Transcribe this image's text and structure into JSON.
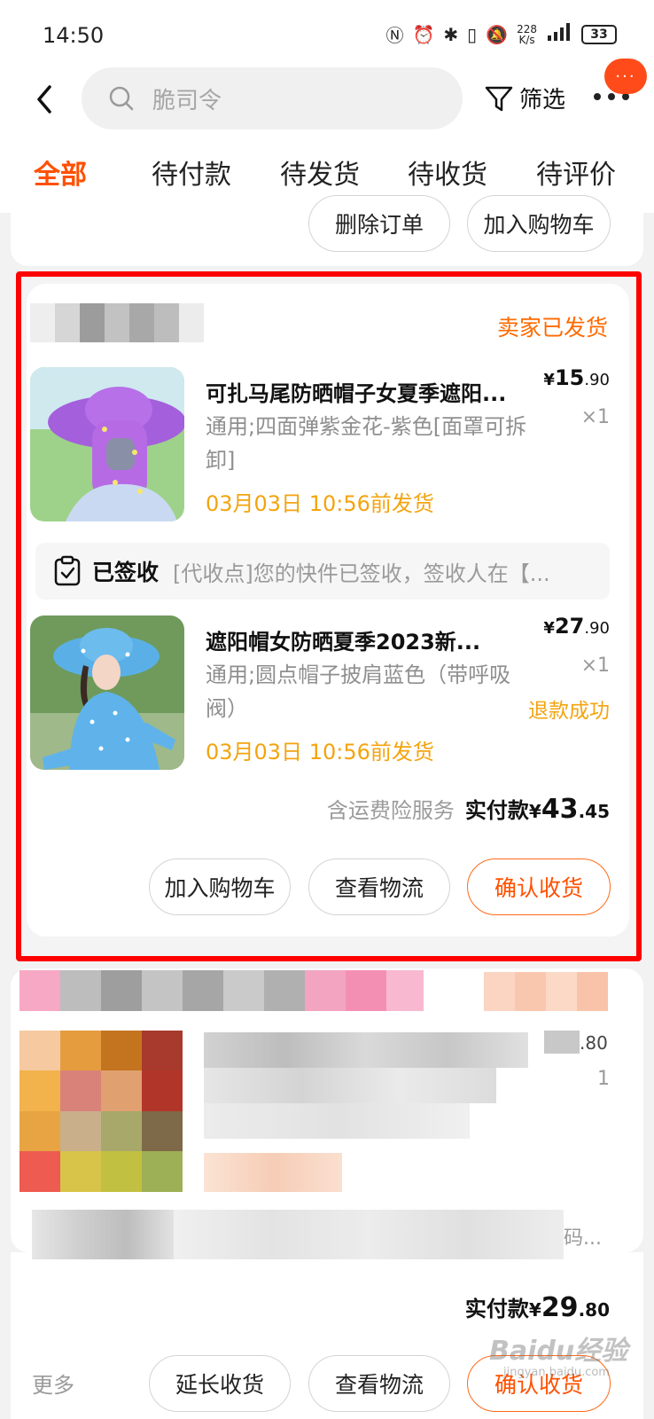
{
  "status_bar": {
    "time": "14:50",
    "net_speed_value": "228",
    "net_speed_unit": "K/s",
    "battery": "33"
  },
  "search": {
    "placeholder": "脆司令"
  },
  "header": {
    "filter_label": "筛选",
    "message_badge": "···"
  },
  "tabs": [
    {
      "label": "全部",
      "active": true
    },
    {
      "label": "待付款",
      "active": false
    },
    {
      "label": "待发货",
      "active": false
    },
    {
      "label": "待收货",
      "active": false
    },
    {
      "label": "待评价",
      "active": false
    }
  ],
  "prev_order": {
    "delete_label": "删除订单",
    "add_cart_label": "加入购物车"
  },
  "order": {
    "status": "卖家已发货",
    "items": [
      {
        "title": "可扎马尾防晒帽子女夏季遮阳...",
        "spec": "通用;四面弹紫金花-紫色[面罩可拆卸]",
        "ship_time": "03月03日 10:56前发货",
        "price_int": "15",
        "price_cents": ".90",
        "qty": "×1",
        "image_name": "purple-sun-hat-photo"
      },
      {
        "title": "遮阳帽女防晒夏季2023新...",
        "spec": "通用;圆点帽子披肩蓝色（带呼吸阀）",
        "ship_time": "03月03日 10:56前发货",
        "price_int": "27",
        "price_cents": ".90",
        "qty": "×1",
        "refund": "退款成功",
        "image_name": "blue-dotted-sun-hat-photo"
      }
    ],
    "logistics": {
      "label": "已签收",
      "detail": "[代收点]您的快件已签收，签收人在【..."
    },
    "total": {
      "service": "含运费险服务",
      "label": "实付款",
      "currency": "¥",
      "amount_int": "43",
      "amount_cents": ".45"
    },
    "buttons": {
      "add_cart": "加入购物车",
      "view_logistics": "查看物流",
      "confirm_receipt": "确认收货"
    }
  },
  "next_order": {
    "price_partial": ".80",
    "qty_partial": "1",
    "logistics_partial": "码...",
    "total_label": "实付款",
    "currency": "¥",
    "total_int": "29",
    "total_cents": ".80",
    "more_label": "更多",
    "buttons": {
      "extend": "延长收货",
      "view_logistics": "查看物流",
      "confirm_receipt": "确认收货"
    }
  },
  "watermark": {
    "text": "Baidu经验",
    "sub": "jingyan.baidu.com"
  },
  "colors": {
    "accent": "#ff5000",
    "ship_time": "#f3a40f",
    "highlight_frame": "#ff0000",
    "badge": "#ff4b19"
  }
}
